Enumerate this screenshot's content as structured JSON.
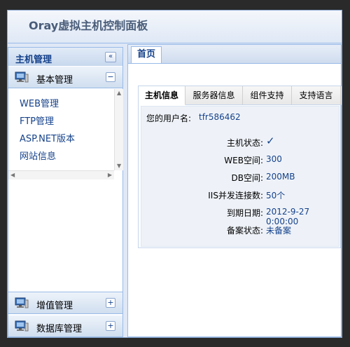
{
  "app": {
    "title": "Oray虚拟主机控制面板"
  },
  "sidebar": {
    "title": "主机管理",
    "collapse_icon": "«",
    "sections": [
      {
        "label": "基本管理",
        "toggle": "−",
        "expanded": true
      },
      {
        "label": "增值管理",
        "toggle": "+",
        "expanded": false
      },
      {
        "label": "数据库管理",
        "toggle": "+",
        "expanded": false
      }
    ],
    "items": [
      {
        "label": "WEB管理"
      },
      {
        "label": "FTP管理"
      },
      {
        "label": "ASP.NET版本"
      },
      {
        "label": "网站信息"
      }
    ]
  },
  "main": {
    "tabs": [
      {
        "label": "首页"
      }
    ],
    "info_tabs": [
      {
        "label": "主机信息",
        "active": true
      },
      {
        "label": "服务器信息",
        "active": false
      },
      {
        "label": "组件支持",
        "active": false
      },
      {
        "label": "支持语言",
        "active": false
      }
    ],
    "username_label": "您的用户名:",
    "username": "tfr586462",
    "rows": [
      {
        "label": "主机状态:",
        "value": "✓"
      },
      {
        "label": "WEB空间:",
        "value": "300"
      },
      {
        "label": "DB空间:",
        "value": "200MB"
      },
      {
        "label": "IIS并发连接数:",
        "value": "50个"
      },
      {
        "label": "到期日期:",
        "value": "2012-9-27 0:00:00"
      },
      {
        "label": "备案状态:",
        "value": "未备案"
      }
    ]
  },
  "colors": {
    "accent": "#15428b",
    "panel_border": "#99bbe8"
  }
}
